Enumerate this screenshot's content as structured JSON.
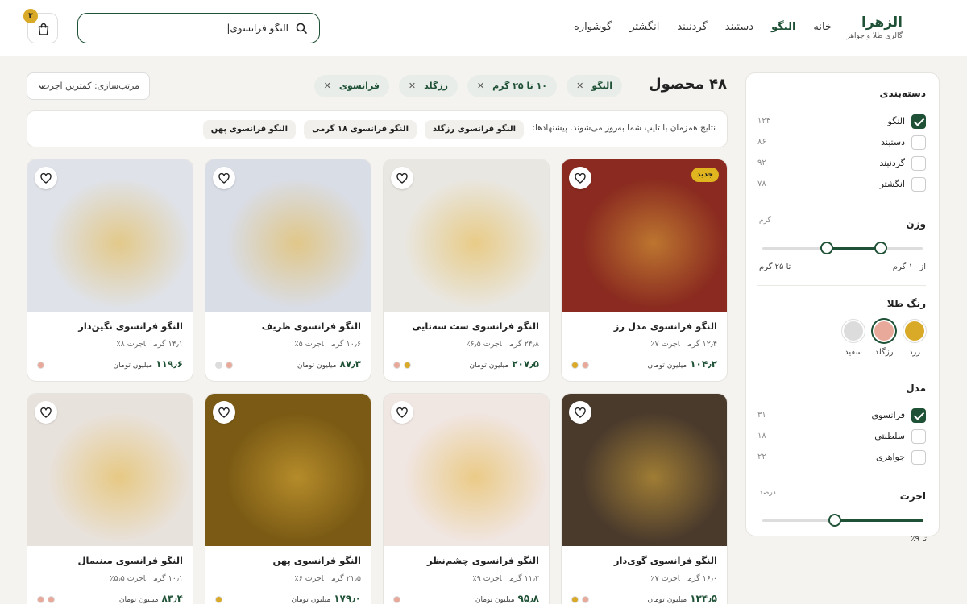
{
  "brand": {
    "name": "الزهرا",
    "tagline": "گالری طلا و جواهر"
  },
  "nav": [
    "خانه",
    "النگو",
    "دستبند",
    "گردنبند",
    "انگشتر",
    "گوشواره"
  ],
  "search": {
    "value": "النگو فرانسوی|"
  },
  "cart": {
    "count": "۳"
  },
  "results": {
    "count_label": "۴۸ محصول"
  },
  "chips": [
    "النگو",
    "۱۰ تا ۲۵ گرم",
    "رزگلد",
    "فرانسوی"
  ],
  "sort": {
    "label": "مرتب‌سازی: کمترین اجرت"
  },
  "suggest": {
    "text": "نتایج همزمان با تایپ شما به‌روز می‌شوند. پیشنهادها:",
    "items": [
      "النگو فرانسوی رزگلد",
      "النگو فرانسوی ۱۸ گرمی",
      "النگو فرانسوی پهن"
    ]
  },
  "filters": {
    "category": {
      "title": "دسته‌بندی",
      "items": [
        {
          "label": "النگو",
          "count": "۱۲۴",
          "checked": true
        },
        {
          "label": "دستبند",
          "count": "۸۶",
          "checked": false
        },
        {
          "label": "گردنبند",
          "count": "۹۲",
          "checked": false
        },
        {
          "label": "انگشتر",
          "count": "۷۸",
          "checked": false
        }
      ]
    },
    "weight": {
      "title": "وزن",
      "unit": "گرم",
      "from_label": "از ۱۰ گرم",
      "to_label": "تا ۲۵ گرم",
      "min_frac": 0.35,
      "max_frac": 0.7
    },
    "color": {
      "title": "رنگ طلا",
      "items": [
        {
          "label": "زرد",
          "color": "#d9a928",
          "selected": false
        },
        {
          "label": "رزگلد",
          "color": "#e8a99a",
          "selected": true
        },
        {
          "label": "سفید",
          "color": "#dcdcdc",
          "selected": false
        }
      ]
    },
    "model": {
      "title": "مدل",
      "items": [
        {
          "label": "فرانسوی",
          "count": "۳۱",
          "checked": true
        },
        {
          "label": "سلطنتی",
          "count": "۱۸",
          "checked": false
        },
        {
          "label": "جواهری",
          "count": "۲۲",
          "checked": false
        }
      ]
    },
    "wage": {
      "title": "اجرت",
      "unit": "درصد",
      "to_label": "تا ۹٪",
      "level_frac": 0.5
    }
  },
  "products": [
    {
      "name": "النگو فرانسوی مدل رز",
      "weight": "۱۲٫۴ گرم",
      "wage": "اجرت ۷٪",
      "price": "۱۰۴٫۲",
      "unit": "میلیون تومان",
      "badge": "جدید",
      "colors": [
        "#e8a99a",
        "#d9a928"
      ],
      "bg": "#8a2a20"
    },
    {
      "name": "النگو فرانسوی ست سه‌تایی",
      "weight": "۲۴٫۸ گرم",
      "wage": "اجرت ۶٫۵٪",
      "price": "۲۰۷٫۵",
      "unit": "میلیون تومان",
      "badge": "",
      "colors": [
        "#d9a928",
        "#e8a99a"
      ],
      "bg": "#e9e7e2"
    },
    {
      "name": "النگو فرانسوی ظریف",
      "weight": "۱۰٫۶ گرم",
      "wage": "اجرت ۵٪",
      "price": "۸۷٫۳",
      "unit": "میلیون تومان",
      "badge": "",
      "colors": [
        "#e8a99a",
        "#dcdcdc"
      ],
      "bg": "#d9dde6"
    },
    {
      "name": "النگو فرانسوی نگین‌دار",
      "weight": "۱۴٫۱ گرم",
      "wage": "اجرت ۸٪",
      "price": "۱۱۹٫۶",
      "unit": "میلیون تومان",
      "badge": "",
      "colors": [
        "#e8a99a"
      ],
      "bg": "#dfe2e8"
    },
    {
      "name": "النگو فرانسوی گوی‌دار",
      "weight": "۱۶٫۰ گرم",
      "wage": "اجرت ۷٪",
      "price": "۱۳۴٫۵",
      "unit": "میلیون تومان",
      "badge": "",
      "colors": [
        "#e8a99a",
        "#d9a928"
      ],
      "bg": "#4a3a2c"
    },
    {
      "name": "النگو فرانسوی چشم‌نظر",
      "weight": "۱۱٫۲ گرم",
      "wage": "اجرت ۹٪",
      "price": "۹۵٫۸",
      "unit": "میلیون تومان",
      "badge": "",
      "colors": [
        "#e8a99a"
      ],
      "bg": "#f0e6e2"
    },
    {
      "name": "النگو فرانسوی پهن",
      "weight": "۲۱٫۵ گرم",
      "wage": "اجرت ۶٪",
      "price": "۱۷۹٫۰",
      "unit": "میلیون تومان",
      "badge": "",
      "colors": [
        "#d9a928"
      ],
      "bg": "#7a5a14"
    },
    {
      "name": "النگو فرانسوی مینیمال",
      "weight": "۱۰٫۱ گرم",
      "wage": "اجرت ۵٫۵٪",
      "price": "۸۳٫۴",
      "unit": "میلیون تومان",
      "badge": "",
      "colors": [
        "#e8a99a",
        "#e8a99a"
      ],
      "bg": "#e8e2dc"
    }
  ]
}
